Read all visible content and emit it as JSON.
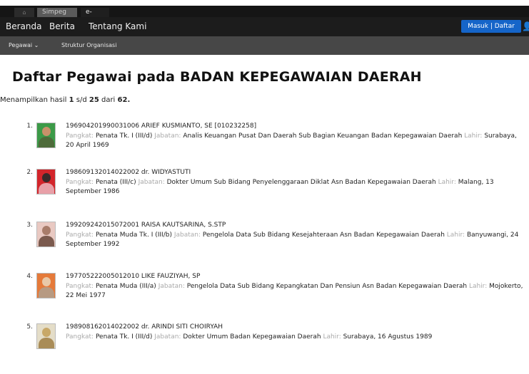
{
  "topbar": {
    "tabs": [
      {
        "label": "⌂"
      },
      {
        "label": "Simpeg"
      },
      {
        "label": "e-Doc"
      }
    ]
  },
  "navbar": {
    "items": [
      "Beranda",
      "Berita",
      "Tentang Kami"
    ],
    "login_label": "Masuk | Daftar"
  },
  "subnav": {
    "items": [
      "Pegawai  ⌄",
      "Struktur Organisasi"
    ]
  },
  "page": {
    "title": "Daftar Pegawai pada BADAN KEPEGAWAIAN DAERAH",
    "summary_prefix": "Menampilkan hasil",
    "summary_from": "1",
    "summary_mid": "s/d",
    "summary_to": "25",
    "summary_of": "dari",
    "summary_total": "62."
  },
  "labels": {
    "pangkat": "Pangkat:",
    "jabatan": "Jabatan:",
    "lahir": "Lahir:"
  },
  "employees": [
    {
      "num": "1.",
      "name": "196904201990031006 ARIEF KUSMIANTO, SE [010232258]",
      "pangkat": "Penata Tk. I (III/d)",
      "jabatan": "Analis Keuangan Pusat Dan Daerah Sub Bagian Keuangan Badan Kepegawaian Daerah",
      "lahir": "Surabaya, 20 April 1969",
      "bg": "#3c9a48",
      "head": "#c9916a",
      "body": "#4e6b3a"
    },
    {
      "num": "2.",
      "name": "198609132014022002 dr. WIDYASTUTI",
      "pangkat": "Penata (III/c)",
      "jabatan": "Dokter Umum Sub Bidang Penyelenggaraan Diklat Asn Badan Kepegawaian Daerah",
      "lahir": "Malang, 13 September 1986",
      "bg": "#d3252b",
      "head": "#3a2a2a",
      "body": "#e8a0a8"
    },
    {
      "num": "3.",
      "name": "199209242015072001 RAISA KAUTSARINA, S.STP",
      "pangkat": "Penata Muda Tk. I (III/b)",
      "jabatan": "Pengelola Data Sub Bidang Kesejahteraan Asn Badan Kepegawaian Daerah",
      "lahir": "Banyuwangi, 24 September 1992",
      "bg": "#e9c9c2",
      "head": "#a87c6a",
      "body": "#7b5a4e"
    },
    {
      "num": "4.",
      "name": "197705222005012010 LIKE FAUZIYAH, SP",
      "pangkat": "Penata Muda (III/a)",
      "jabatan": "Pengelola Data Sub Bidang Kepangkatan Dan Pensiun Asn Badan Kepegawaian Daerah",
      "lahir": "Mojokerto, 22 Mei 1977",
      "bg": "#e57a3a",
      "head": "#e9c9a8",
      "body": "#b79a82"
    },
    {
      "num": "5.",
      "name": "198908162014022002 dr. ARINDI SITI CHOIRYAH",
      "pangkat": "Penata Tk. I (III/d)",
      "jabatan": "Dokter Umum Badan Kepegawaian Daerah",
      "lahir": "Surabaya, 16 Agustus 1989",
      "bg": "#e4ddc8",
      "head": "#c8a868",
      "body": "#a98c58"
    }
  ]
}
